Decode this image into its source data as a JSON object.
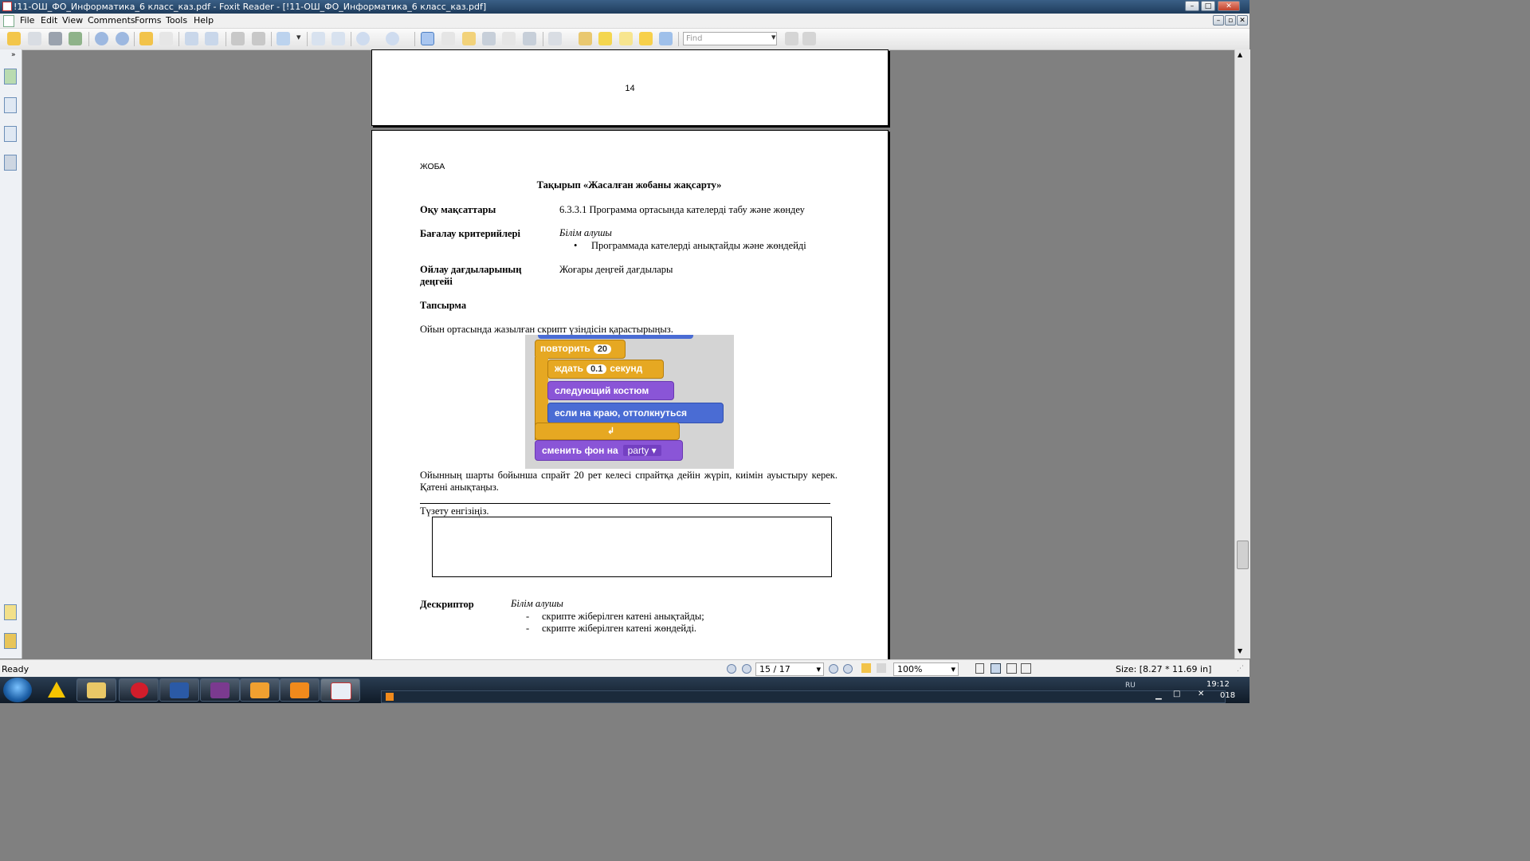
{
  "window": {
    "title": "!11-ОШ_ФО_Информатика_6 класс_каз.pdf - Foxit Reader - [!11-ОШ_ФО_Информатика_6 класс_каз.pdf]"
  },
  "menu": [
    "File",
    "Edit",
    "View",
    "Comments",
    "Forms",
    "Tools",
    "Help"
  ],
  "toolbar": {
    "find_placeholder": "Find",
    "icons": [
      "open-icon",
      "save-icon",
      "print-icon",
      "email-icon",
      "prev-page-icon",
      "next-page-icon",
      "back-icon",
      "forward-icon",
      "extract-page-icon",
      "insert-page-icon",
      "undo-icon",
      "redo-icon",
      "zoom-in-icon",
      "rotate-left-icon",
      "rotate-right-icon",
      "zoom-out-icon",
      "zoom-plus-icon",
      "hand-tool-icon",
      "select-text-icon",
      "select-annotation-icon",
      "find-icon",
      "typewriter-icon",
      "snapshot-icon",
      "pen-icon",
      "eraser-icon",
      "highlight-icon",
      "text-box-icon",
      "note-icon",
      "arrow-icon"
    ]
  },
  "page_prev": {
    "page_number": "14"
  },
  "page_current": {
    "header_label": "ЖОБА",
    "title": "Тақырып «Жасалған жобаны жақсарту»",
    "rows": [
      {
        "label": "Оқу мақсаттары",
        "value": "6.3.3.1 Программа ортасында кателерді табу және жөндеу"
      },
      {
        "label": "Бағалау критерийлері",
        "value_italic": "Білім алушы",
        "bullet": "Программада кателерді анықтайды және жөндейді"
      },
      {
        "label": "Ойлау дағдыларының деңгейі",
        "value": "Жоғары деңгей дағдылары"
      }
    ],
    "task_label": "Тапсырма",
    "task_intro": "Ойын ортасында жазылған скрипт үзіндісін қарастырыңыз.",
    "scratch": {
      "repeat": "повторить",
      "repeat_count": "20",
      "wait": "ждать",
      "wait_value": "0.1",
      "wait_unit": "секунд",
      "next_costume": "следующий костюм",
      "bounce": "если на краю, оттолкнуться",
      "switch_backdrop": "сменить фон на",
      "backdrop_value": "party"
    },
    "task_text": "Ойынның шарты бойынша спрайт 20 рет келесі спрайтқа дейін жүріп, киімін ауыстыру керек. Қатені анықтаңыз.",
    "fix_prompt": "Түзету енгізіңіз.",
    "descriptor_label": "Дескриптор",
    "descriptor_italic": "Білім алушы",
    "descriptor_items": [
      "скрипте жіберілген катені анықтайды;",
      "скрипте жіберілген катені жөндейді."
    ]
  },
  "status": {
    "ready": "Ready",
    "page_field": "15 / 17",
    "zoom": "100%",
    "size": "Size: [8.27 * 11.69 in]"
  },
  "taskbar": {
    "apps": [
      "explorer-icon",
      "opera-icon",
      "word-icon",
      "winrar-icon",
      "scratch-icon",
      "media-player-icon",
      "foxit-icon"
    ],
    "time": "19:12",
    "date_fragment": "018",
    "lang": "RU"
  }
}
